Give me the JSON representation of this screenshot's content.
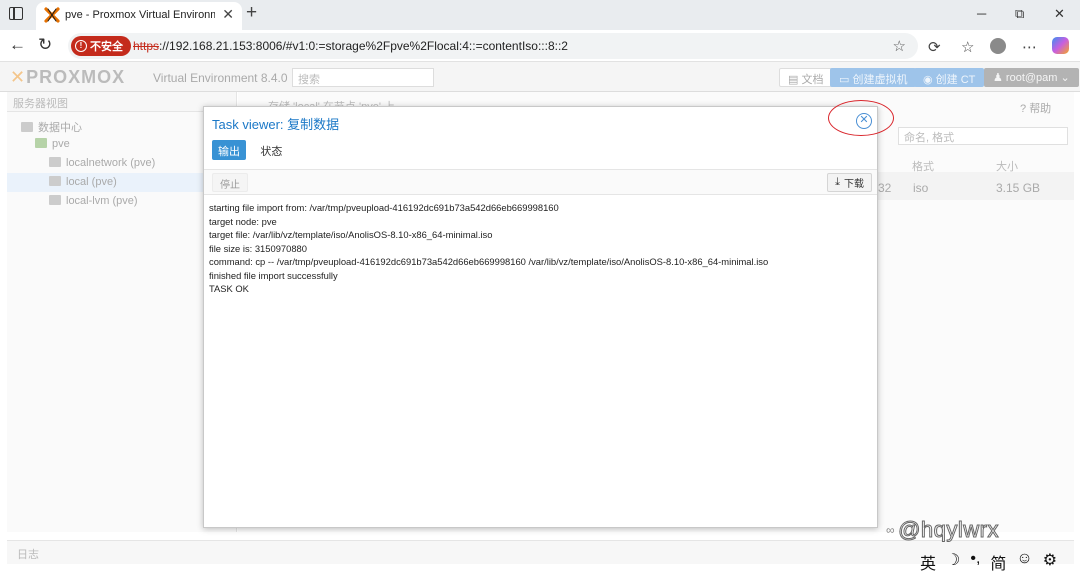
{
  "browser": {
    "tab_title": "pve - Proxmox Virtual Environment",
    "tab_close": "✕",
    "new_tab": "+",
    "window_controls": {
      "minimize": "─",
      "restore": "⧉",
      "close": "✕"
    },
    "nav": {
      "back": "←",
      "refresh": "↻"
    },
    "security_label": "不安全",
    "url_scheme": "https",
    "url_rest": "://192.168.21.153:8006/#v1:0:=storage%2Fpve%2Flocal:4::=contentIso:::8::2",
    "icons": [
      "star-icon",
      "extensions-icon",
      "favorites-icon",
      "profile-icon",
      "more-icon",
      "copilot-icon"
    ]
  },
  "pve": {
    "logo": "PROXMOX",
    "version": "Virtual Environment 8.4.0",
    "search_placeholder": "搜索",
    "header_buttons": {
      "docs": "文档",
      "create_vm": "创建虚拟机",
      "create_ct": "创建 CT",
      "user": "root@pam"
    },
    "sidebar_view": "服务器视图",
    "tree": [
      {
        "label": "数据中心",
        "icon": "datacenter-icon"
      },
      {
        "label": "pve",
        "icon": "node-icon"
      },
      {
        "label": "localnetwork (pve)",
        "icon": "network-icon"
      },
      {
        "label": "local (pve)",
        "icon": "storage-icon"
      },
      {
        "label": "local-lvm (pve)",
        "icon": "storage-icon"
      }
    ],
    "breadcrumb": "存储 'local' 在节点 'pve' 上",
    "help": "帮助",
    "filter_placeholder": "命名, 格式",
    "columns": {
      "format": "格式",
      "size": "大小"
    },
    "row": {
      "date_tail": "32",
      "format": "iso",
      "size": "3.15 GB"
    },
    "log_label": "日志"
  },
  "task_viewer": {
    "title_prefix": "Task viewer:",
    "title_task": "复制数据",
    "tabs": [
      "输出",
      "状态"
    ],
    "stop_label": "停止",
    "download_label": "下载",
    "log_lines": [
      "starting file import from: /var/tmp/pveupload-416192dc691b73a542d66eb669998160",
      "target node: pve",
      "target file: /var/lib/vz/template/iso/AnolisOS-8.10-x86_64-minimal.iso",
      "file size is: 3150970880",
      "command: cp -- /var/tmp/pveupload-416192dc691b73a542d66eb669998160 /var/lib/vz/template/iso/AnolisOS-8.10-x86_64-minimal.iso",
      "finished file import successfully",
      "TASK OK"
    ]
  },
  "watermark": "@hqylwrx",
  "ime": [
    "英",
    "☽",
    "•,",
    "简",
    "☺",
    "⚙"
  ],
  "colors": {
    "accent": "#3892d4",
    "title_blue": "#1b78c7",
    "insecure_red": "#c42b1c",
    "annotation_red": "#d9262c"
  }
}
